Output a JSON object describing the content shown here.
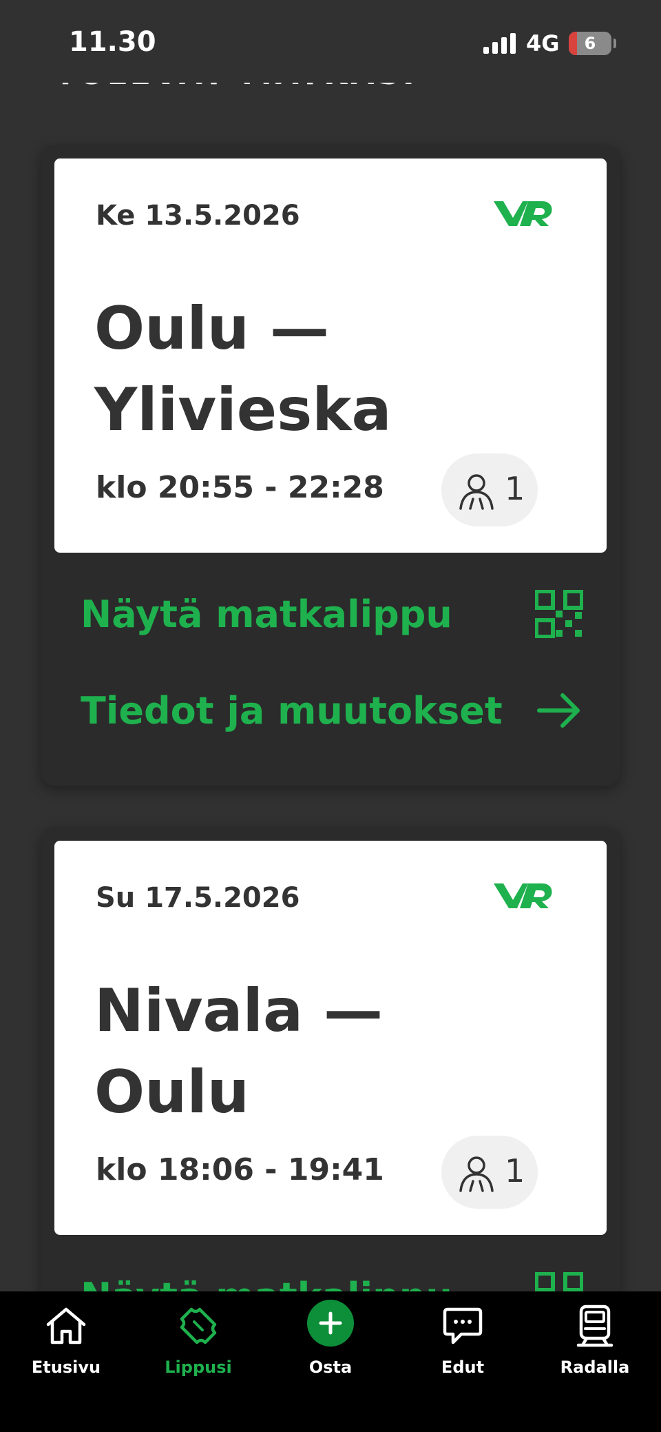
{
  "status": {
    "time": "11.30",
    "network": "4G",
    "battery": "6"
  },
  "section_title": "TULEVAT MATKASI",
  "trips": [
    {
      "date": "Ke 13.5.2026",
      "brand": "VR",
      "route_line1": "Oulu —",
      "route_line2": "Ylivieska",
      "time": "klo 20:55 - 22:28",
      "passengers": "1",
      "show_ticket_label": "Näytä matkalippu",
      "details_label": "Tiedot ja muutokset"
    },
    {
      "date": "Su 17.5.2026",
      "brand": "VR",
      "route_line1": "Nivala —",
      "route_line2": "Oulu",
      "time": "klo 18:06 - 19:41",
      "passengers": "1",
      "show_ticket_label": "Näytä matkalippu"
    }
  ],
  "tabs": [
    {
      "label": "Etusivu",
      "icon": "home-icon"
    },
    {
      "label": "Lippusi",
      "icon": "ticket-icon"
    },
    {
      "label": "Osta",
      "icon": "plus-icon"
    },
    {
      "label": "Edut",
      "icon": "chat-icon"
    },
    {
      "label": "Radalla",
      "icon": "train-icon"
    }
  ],
  "colors": {
    "accent": "#1eb14e",
    "background": "#313131",
    "card": "#2b2b2b"
  }
}
